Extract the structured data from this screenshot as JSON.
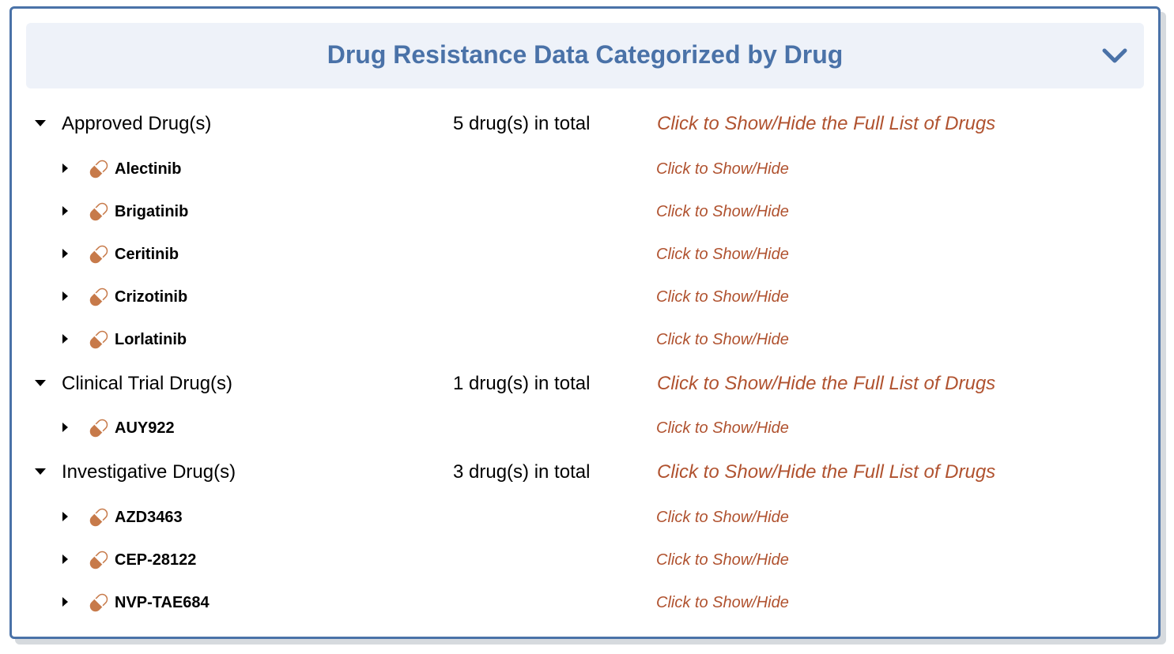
{
  "header": {
    "title": "Drug Resistance Data Categorized by Drug",
    "chevron_icon": "chevron-down-icon"
  },
  "colors": {
    "accent": "#4a72a8",
    "header_bg": "#eef2f9",
    "link": "#b0522f",
    "pill": "#c77a4a"
  },
  "categories": [
    {
      "label": "Approved Drug(s)",
      "count": "5 drug(s) in total",
      "toggle": "Click to Show/Hide the Full List of Drugs",
      "drugs": [
        {
          "name": "Alectinib",
          "toggle": "Click to Show/Hide"
        },
        {
          "name": "Brigatinib",
          "toggle": "Click to Show/Hide"
        },
        {
          "name": "Ceritinib",
          "toggle": "Click to Show/Hide"
        },
        {
          "name": "Crizotinib",
          "toggle": "Click to Show/Hide"
        },
        {
          "name": "Lorlatinib",
          "toggle": "Click to Show/Hide"
        }
      ]
    },
    {
      "label": "Clinical Trial Drug(s)",
      "count": "1 drug(s) in total",
      "toggle": "Click to Show/Hide the Full List of Drugs",
      "drugs": [
        {
          "name": "AUY922",
          "toggle": "Click to Show/Hide"
        }
      ]
    },
    {
      "label": "Investigative Drug(s)",
      "count": "3 drug(s) in total",
      "toggle": "Click to Show/Hide the Full List of Drugs",
      "drugs": [
        {
          "name": "AZD3463",
          "toggle": "Click to Show/Hide"
        },
        {
          "name": "CEP-28122",
          "toggle": "Click to Show/Hide"
        },
        {
          "name": "NVP-TAE684",
          "toggle": "Click to Show/Hide"
        }
      ]
    }
  ]
}
